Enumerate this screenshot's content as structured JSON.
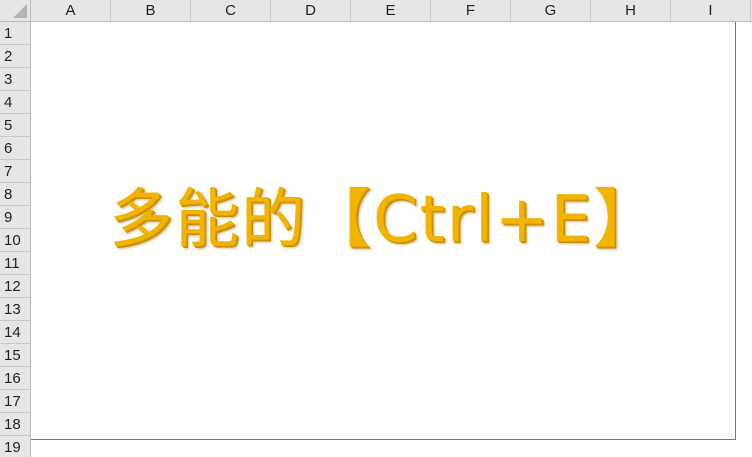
{
  "spreadsheet": {
    "columns": [
      "A",
      "B",
      "C",
      "D",
      "E",
      "F",
      "G",
      "H",
      "I"
    ],
    "rows": [
      "1",
      "2",
      "3",
      "4",
      "5",
      "6",
      "7",
      "8",
      "9",
      "10",
      "11",
      "12",
      "13",
      "14",
      "15",
      "16",
      "17",
      "18",
      "19"
    ],
    "wordart_text": "多能的【Ctrl+E】",
    "wordart_color": "#f2b400",
    "header_bg": "#e6e6e6"
  }
}
